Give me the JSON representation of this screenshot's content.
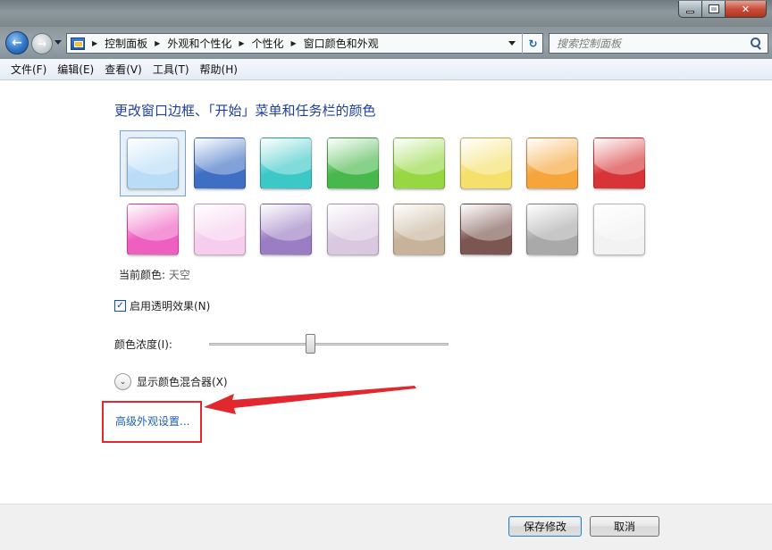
{
  "window": {
    "controls": {
      "minimize": "—",
      "maximize": "□",
      "close": "✕"
    }
  },
  "nav": {
    "back_glyph": "←",
    "forward_glyph": "→",
    "breadcrumbs": [
      "控制面板",
      "外观和个性化",
      "个性化",
      "窗口颜色和外观"
    ],
    "refresh_glyph": "↻",
    "search_placeholder": "搜索控制面板"
  },
  "menu": [
    "文件(F)",
    "编辑(E)",
    "查看(V)",
    "工具(T)",
    "帮助(H)"
  ],
  "content": {
    "heading": "更改窗口边框、「开始」菜单和任务栏的颜色",
    "swatches_row1": [
      {
        "name": "sky",
        "color": "#b9dcf7",
        "selected": true
      },
      {
        "name": "twilight",
        "color": "#3f6fc4"
      },
      {
        "name": "sea",
        "color": "#3cc8c6"
      },
      {
        "name": "leaf",
        "color": "#49b84c"
      },
      {
        "name": "lime",
        "color": "#96d742"
      },
      {
        "name": "sun",
        "color": "#f4e06b"
      },
      {
        "name": "pumpkin",
        "color": "#f6a53a"
      },
      {
        "name": "ruby",
        "color": "#d83438"
      }
    ],
    "swatches_row2": [
      {
        "name": "fuchsia",
        "color": "#ee5fc0"
      },
      {
        "name": "blush",
        "color": "#f6cdee"
      },
      {
        "name": "violet",
        "color": "#9a7dc2"
      },
      {
        "name": "lavender",
        "color": "#dac8e0"
      },
      {
        "name": "taupe",
        "color": "#c6b39a"
      },
      {
        "name": "chocolate",
        "color": "#7c5650"
      },
      {
        "name": "slate",
        "color": "#a9a9a9"
      },
      {
        "name": "frost",
        "color": "#f2f2f2"
      }
    ],
    "current_color_label": "当前颜色:",
    "current_color_value": "天空",
    "transparency_checked": true,
    "transparency_check_glyph": "✓",
    "transparency_label": "启用透明效果(N)",
    "intensity_label": "颜色浓度(I):",
    "intensity_value": 0.42,
    "mixer_glyph": "⌄",
    "mixer_label": "显示颜色混合器(X)",
    "advanced_link": "高级外观设置..."
  },
  "annotation": {
    "color": "#e0282e"
  },
  "buttons": {
    "save": "保存修改",
    "cancel": "取消"
  }
}
